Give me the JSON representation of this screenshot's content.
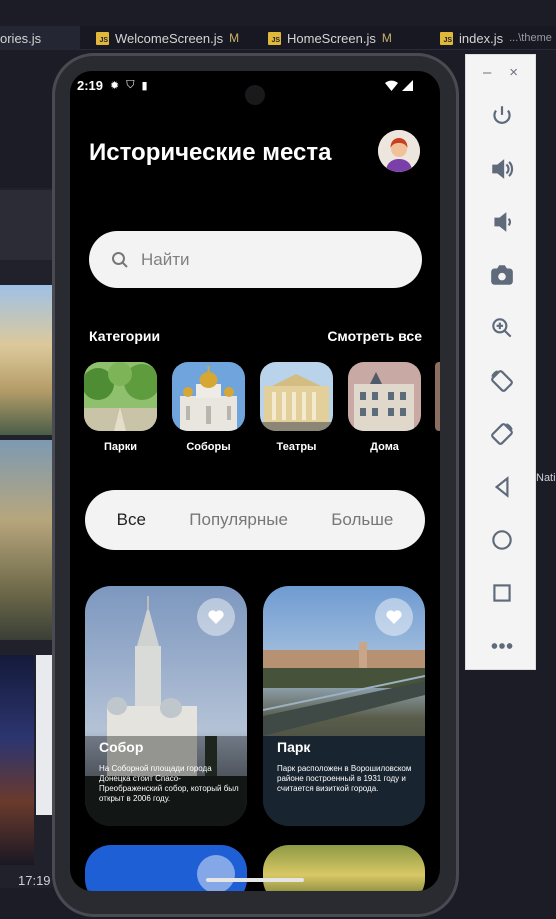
{
  "ide": {
    "tabs": [
      {
        "label": "ories.js",
        "mod": "M",
        "icon": "js-file-icon"
      },
      {
        "label": "WelcomeScreen.js",
        "mod": "M",
        "icon": "js-file-icon"
      },
      {
        "label": "HomeScreen.js",
        "mod": "M",
        "icon": "js-file-icon"
      },
      {
        "label": "index.js",
        "hint": "...\\theme",
        "icon": "js-file-icon"
      }
    ],
    "left_time": "17:19",
    "right_edge_text": "Nati"
  },
  "emulator_toolbar": {
    "minimize": "–",
    "close": "×",
    "buttons": [
      "power-icon",
      "volume-up-icon",
      "volume-down-icon",
      "camera-icon",
      "zoom-icon",
      "rotate-left-icon",
      "rotate-right-icon",
      "back-icon",
      "home-icon",
      "overview-icon",
      "more-icon"
    ]
  },
  "status_bar": {
    "time": "2:19"
  },
  "app": {
    "title": "Исторические места",
    "search_placeholder": "Найти",
    "categories_title": "Категории",
    "see_all": "Смотреть все",
    "categories": [
      {
        "label": "Парки"
      },
      {
        "label": "Соборы"
      },
      {
        "label": "Театры"
      },
      {
        "label": "Дома"
      }
    ],
    "filters": [
      {
        "label": "Все",
        "active": true
      },
      {
        "label": "Популярные",
        "active": false
      },
      {
        "label": "Больше",
        "active": false
      }
    ],
    "cards": [
      {
        "title": "Собор",
        "description": "На Соборной площади города Донецка стоит Спасо-Преображенский собор, который был открыт в 2006 году."
      },
      {
        "title": "Парк",
        "description": "Парк расположен в Ворошиловском районе построенный в 1931 году и считается визиткой города."
      }
    ]
  }
}
